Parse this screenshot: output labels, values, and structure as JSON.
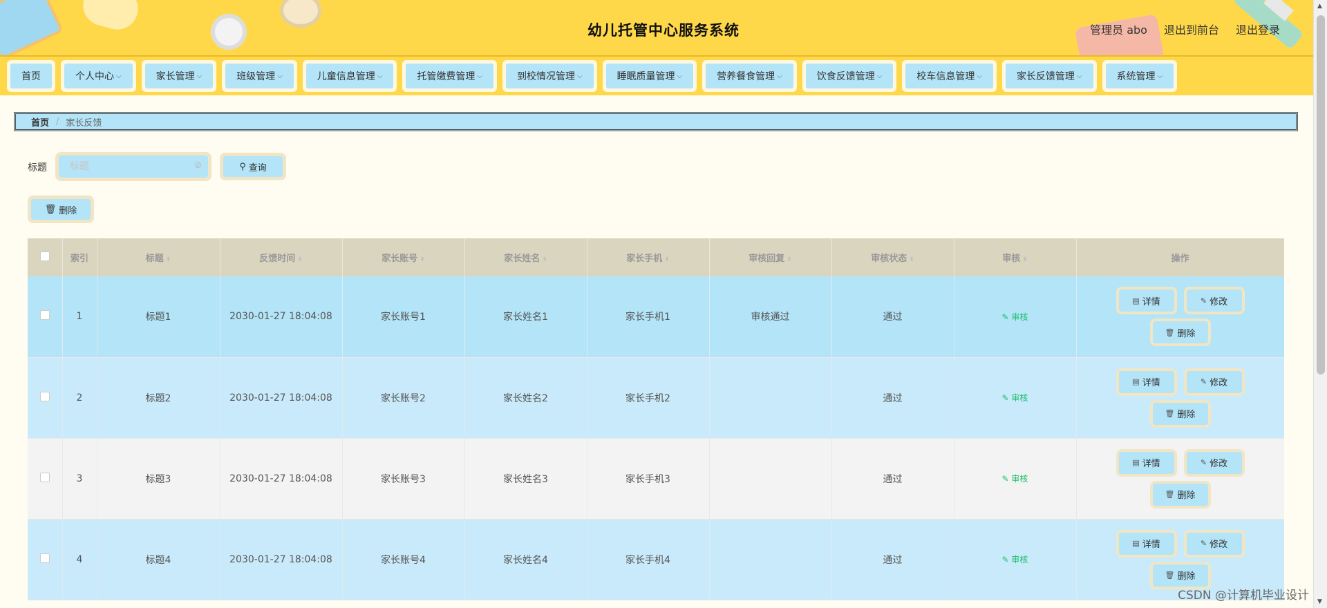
{
  "header": {
    "title": "幼儿托管中心服务系统",
    "admin_label": "管理员 abo",
    "back_to_front": "退出到前台",
    "logout": "退出登录"
  },
  "nav": {
    "items": [
      {
        "label": "首页",
        "has_dropdown": false
      },
      {
        "label": "个人中心",
        "has_dropdown": true
      },
      {
        "label": "家长管理",
        "has_dropdown": true
      },
      {
        "label": "班级管理",
        "has_dropdown": true
      },
      {
        "label": "儿童信息管理",
        "has_dropdown": true
      },
      {
        "label": "托管缴费管理",
        "has_dropdown": true
      },
      {
        "label": "到校情况管理",
        "has_dropdown": true
      },
      {
        "label": "睡眠质量管理",
        "has_dropdown": true
      },
      {
        "label": "营养餐食管理",
        "has_dropdown": true
      },
      {
        "label": "饮食反馈管理",
        "has_dropdown": true
      },
      {
        "label": "校车信息管理",
        "has_dropdown": true
      },
      {
        "label": "家长反馈管理",
        "has_dropdown": true
      },
      {
        "label": "系统管理",
        "has_dropdown": true
      }
    ]
  },
  "breadcrumb": {
    "home": "首页",
    "separator": "/",
    "current": "家长反馈"
  },
  "search": {
    "label": "标题",
    "placeholder": "标题",
    "query_button": "查询"
  },
  "toolbar": {
    "delete_button": "删除"
  },
  "table": {
    "columns": [
      "索引",
      "标题",
      "反馈时间",
      "家长账号",
      "家长姓名",
      "家长手机",
      "审核回复",
      "审核状态",
      "审核",
      "操作"
    ],
    "rows": [
      {
        "index": "1",
        "title": "标题1",
        "time": "2030-01-27 18:04:08",
        "account": "家长账号1",
        "name": "家长姓名1",
        "phone": "家长手机1",
        "reply": "审核通过",
        "status": "通过",
        "audit": "审核"
      },
      {
        "index": "2",
        "title": "标题2",
        "time": "2030-01-27 18:04:08",
        "account": "家长账号2",
        "name": "家长姓名2",
        "phone": "家长手机2",
        "reply": "",
        "status": "通过",
        "audit": "审核"
      },
      {
        "index": "3",
        "title": "标题3",
        "time": "2030-01-27 18:04:08",
        "account": "家长账号3",
        "name": "家长姓名3",
        "phone": "家长手机3",
        "reply": "",
        "status": "通过",
        "audit": "审核"
      },
      {
        "index": "4",
        "title": "标题4",
        "time": "2030-01-27 18:04:08",
        "account": "家长账号4",
        "name": "家长姓名4",
        "phone": "家长手机4",
        "reply": "",
        "status": "通过",
        "audit": "审核"
      }
    ],
    "row_actions": {
      "detail": "详情",
      "edit": "修改",
      "delete": "删除"
    }
  },
  "watermark": "CSDN @计算机毕业设计",
  "colors": {
    "header_bg": "#ffd84a",
    "button_bg": "#b3e4f7",
    "button_border": "#f0e6c6",
    "table_header_bg": "#d9d5bf",
    "audit_link": "#19be6b",
    "page_bg": "#fffdf1"
  },
  "icons": {
    "search": "search-icon",
    "delete": "trash-icon",
    "detail": "document-icon",
    "edit": "pencil-icon",
    "dropdown": "chevron-down-icon",
    "sort": "sort-icon"
  }
}
